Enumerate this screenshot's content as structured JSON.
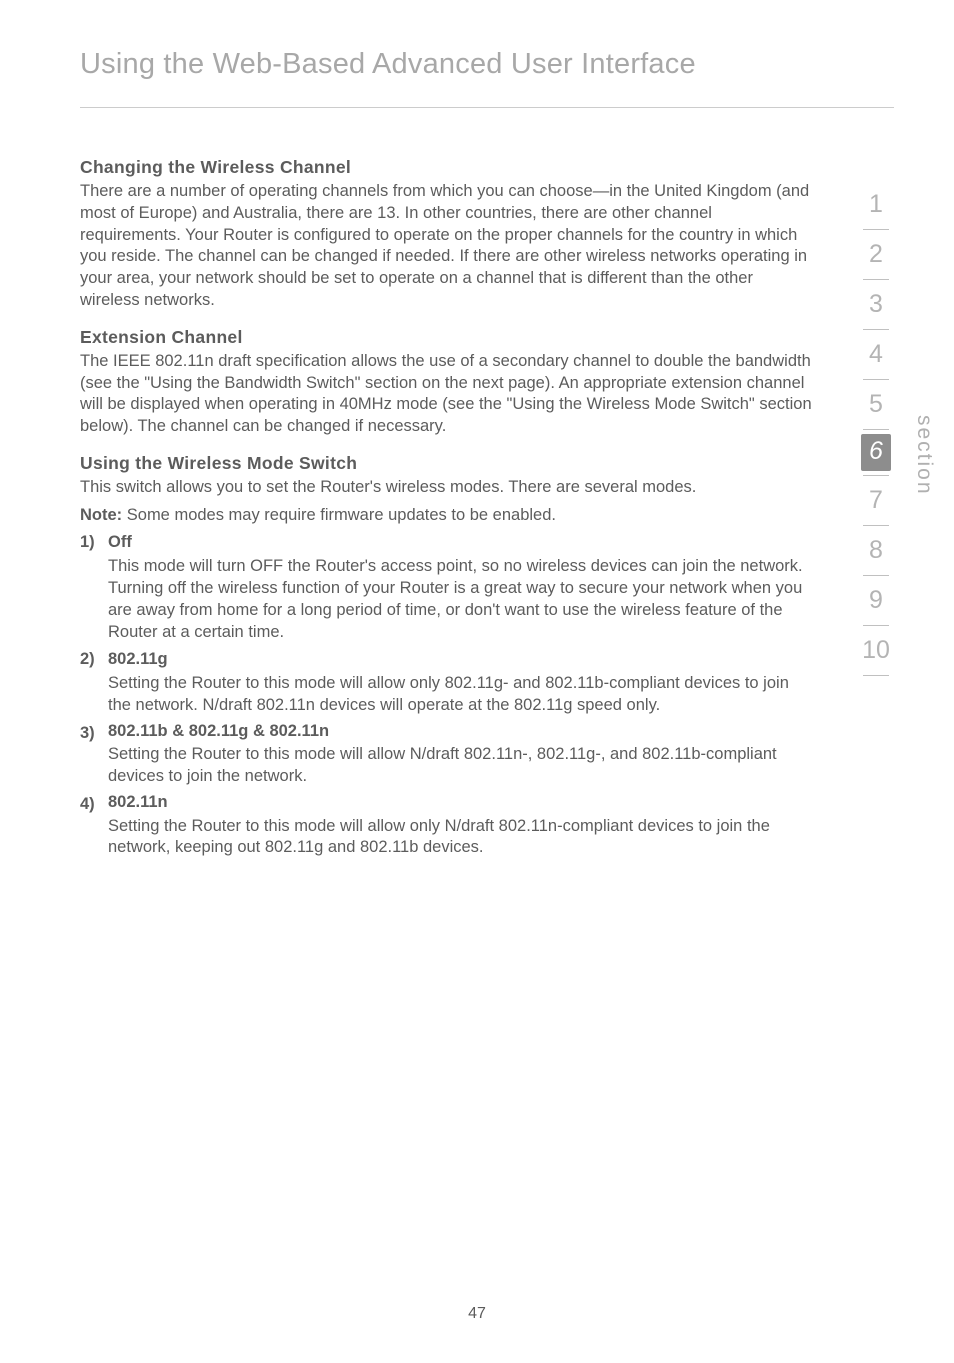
{
  "header": {
    "title": "Using the Web-Based Advanced User Interface"
  },
  "sections": {
    "changing_channel": {
      "heading": "Changing the Wireless Channel",
      "body": "There are a number of operating channels from which you can choose—in the United Kingdom (and most of Europe) and Australia, there are 13. In other countries, there are other channel requirements. Your Router is configured to operate on the proper channels for the country in which you reside. The channel can be changed if needed. If there are other wireless networks operating in your area, your network should be set to operate on a channel that is different than the other wireless networks."
    },
    "extension_channel": {
      "heading": "Extension Channel",
      "body": "The IEEE 802.11n draft specification allows the use of a secondary channel to double the bandwidth (see the \"Using the Bandwidth Switch\" section on the next page). An appropriate extension channel will be displayed when operating in 40MHz mode (see the \"Using the Wireless Mode Switch\" section below). The channel can be changed if necessary."
    },
    "mode_switch": {
      "heading": "Using the Wireless Mode Switch",
      "intro": "This switch allows you to set the Router's wireless modes. There are several modes.",
      "note_bold": "Note:",
      "note_text": " Some modes may require firmware updates to be enabled.",
      "items": [
        {
          "num": "1)",
          "title": "Off",
          "text": "This mode will turn OFF the Router's access point, so no wireless devices can join the network. Turning off the wireless function of your Router is a great way to secure your network when you are away from home for a long period of time, or don't want to use the wireless feature of the Router at a certain time."
        },
        {
          "num": "2)",
          "title": "802.11g",
          "text": "Setting the Router to this mode will allow only 802.11g- and 802.11b-compliant devices to join the network. N/draft 802.11n devices will operate at the 802.11g speed only."
        },
        {
          "num": "3)",
          "title": "802.11b & 802.11g & 802.11n",
          "text": "Setting the Router to this mode will allow N/draft 802.11n-, 802.11g-, and 802.11b-compliant devices to join the network."
        },
        {
          "num": "4)",
          "title": "802.11n",
          "text": "Setting the Router to this mode will allow only N/draft 802.11n-compliant devices to join the network, keeping out 802.11g and 802.11b devices."
        }
      ]
    }
  },
  "sidebar": {
    "tabs": [
      "1",
      "2",
      "3",
      "4",
      "5",
      "6",
      "7",
      "8",
      "9",
      "10"
    ],
    "active": "6",
    "label": "section"
  },
  "footer": {
    "page_number": "47"
  }
}
